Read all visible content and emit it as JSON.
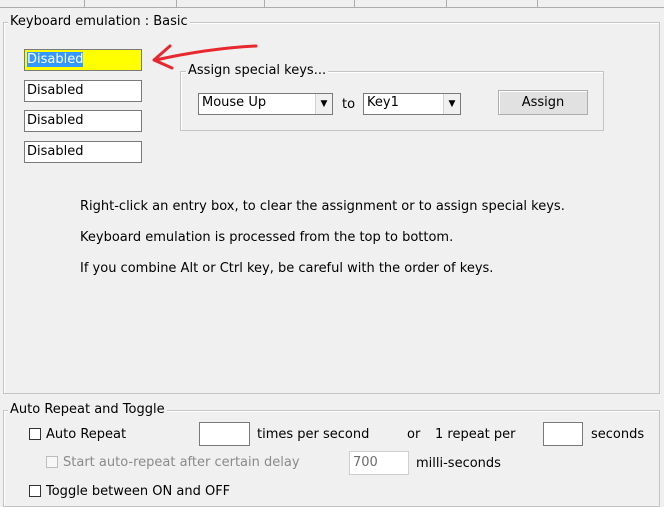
{
  "keyboard_group": {
    "title": "Keyboard emulation : Basic",
    "entries": [
      "Disabled",
      "Disabled",
      "Disabled",
      "Disabled"
    ]
  },
  "special_keys": {
    "title": "Assign special keys...",
    "from_select": "Mouse Up",
    "to_label": "to",
    "to_select": "Key1",
    "assign_button": "Assign"
  },
  "info_lines": [
    "Right-click an entry box, to clear the assignment or to assign special keys.",
    "Keyboard emulation is processed from the top to bottom.",
    "If you combine Alt or Ctrl key, be careful with the order of keys."
  ],
  "auto_repeat_group": {
    "title": "Auto Repeat and Toggle",
    "auto_repeat_label": "Auto Repeat",
    "times_value": "",
    "times_label": "times per second",
    "or_label": "or",
    "one_repeat_label": "1 repeat per",
    "seconds_value": "",
    "seconds_label": "seconds",
    "delay_label": "Start auto-repeat after certain delay",
    "delay_value": "700",
    "ms_label": "milli-seconds",
    "toggle_label": "Toggle between ON and OFF"
  },
  "colors": {
    "highlight_entry": "#ffff00",
    "selection": "#3399ff",
    "arrow": "#e8282e"
  }
}
